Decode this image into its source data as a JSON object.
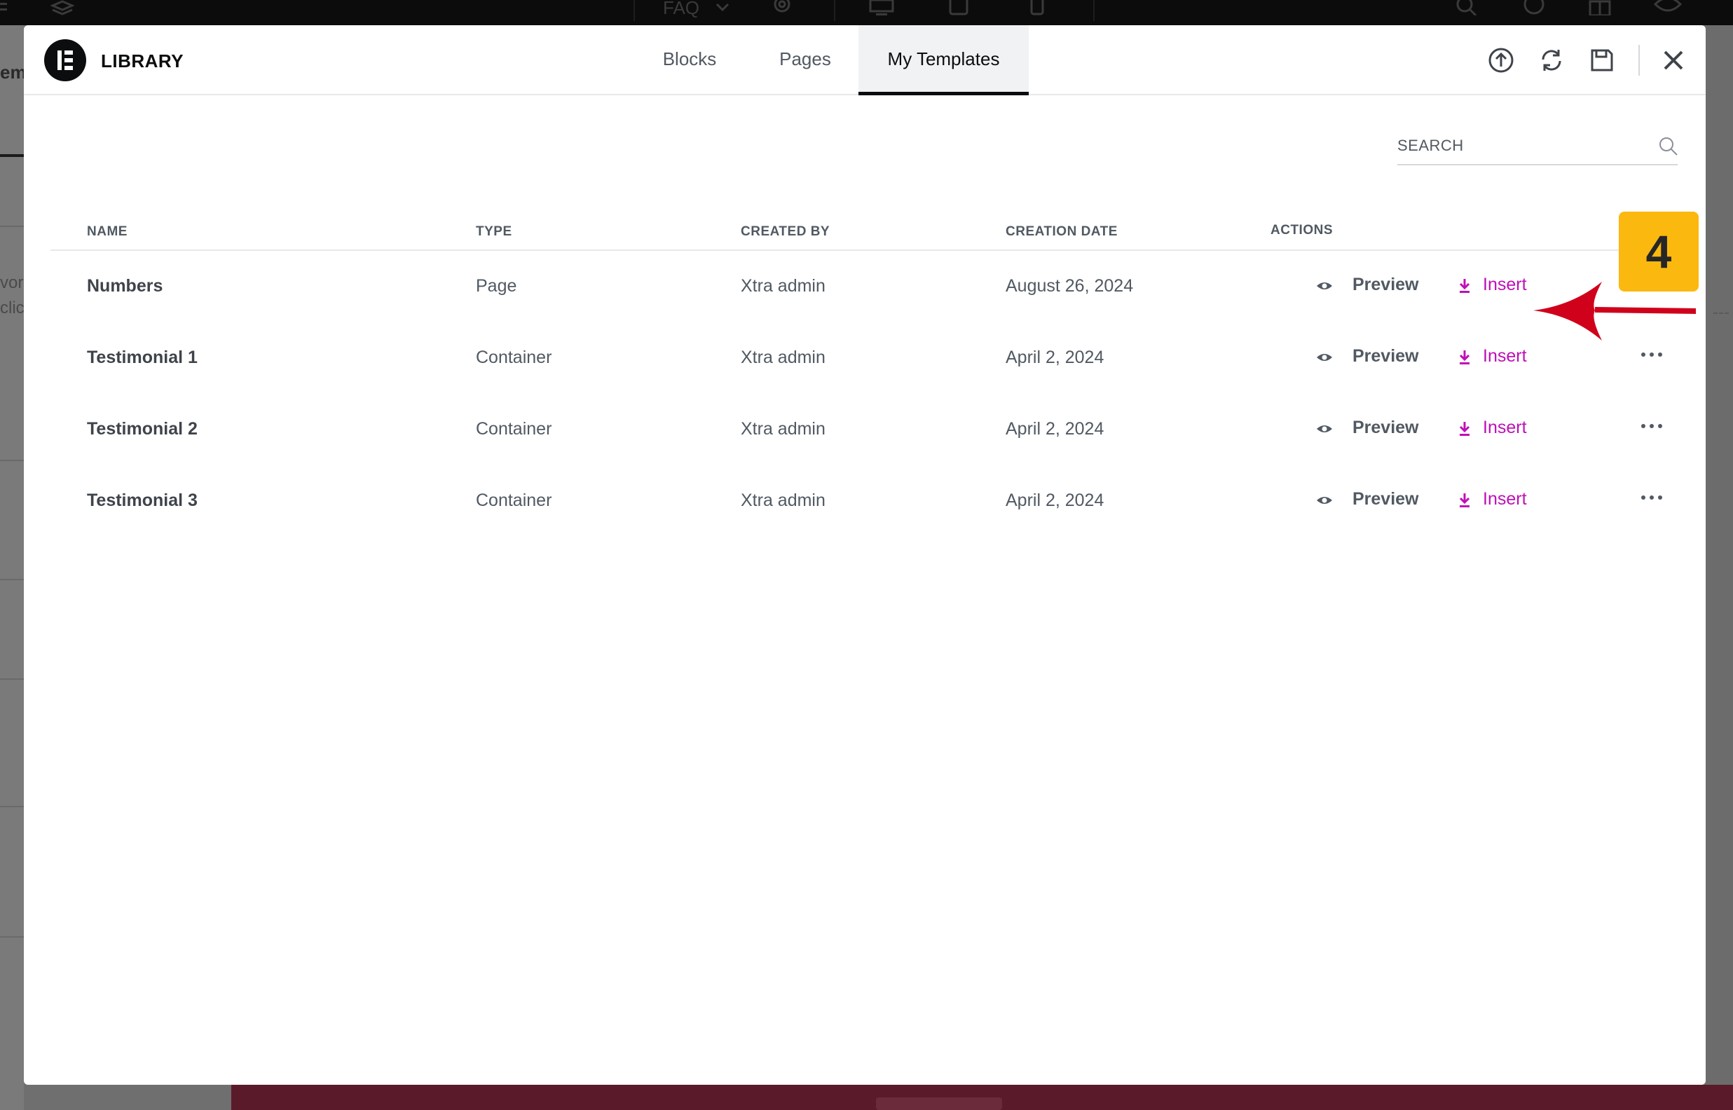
{
  "background": {
    "topbar_items": [
      "FAQ"
    ],
    "left_fragments": [
      "em",
      "vor",
      "clic"
    ]
  },
  "modal": {
    "brand": "LIBRARY",
    "tabs": [
      {
        "label": "Blocks",
        "active": false
      },
      {
        "label": "Pages",
        "active": false
      },
      {
        "label": "My Templates",
        "active": true
      }
    ],
    "header_icons": [
      "upload-icon",
      "sync-icon",
      "save-icon",
      "close-icon"
    ]
  },
  "search": {
    "placeholder": "SEARCH",
    "value": ""
  },
  "table": {
    "columns": [
      "NAME",
      "TYPE",
      "CREATED BY",
      "CREATION DATE",
      "ACTIONS"
    ],
    "preview_label": "Preview",
    "insert_label": "Insert",
    "rows": [
      {
        "name": "Numbers",
        "type": "Page",
        "created_by": "Xtra admin",
        "date": "August 26, 2024"
      },
      {
        "name": "Testimonial 1",
        "type": "Container",
        "created_by": "Xtra admin",
        "date": "April 2, 2024"
      },
      {
        "name": "Testimonial 2",
        "type": "Container",
        "created_by": "Xtra admin",
        "date": "April 2, 2024"
      },
      {
        "name": "Testimonial 3",
        "type": "Container",
        "created_by": "Xtra admin",
        "date": "April 2, 2024"
      }
    ]
  },
  "annotation": {
    "step_number": "4",
    "badge_color": "#fbb80f",
    "arrow_color": "#d0021b"
  },
  "colors": {
    "accent_insert": "#c00fb7",
    "text_muted": "#515962",
    "logo_bg": "#0c0d0e"
  }
}
